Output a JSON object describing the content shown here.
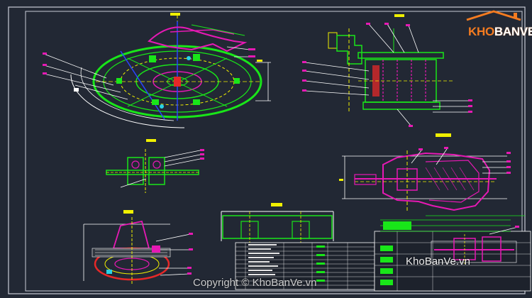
{
  "brand": {
    "logo_kho": "KHO",
    "logo_banve": "BANVE",
    "watermark": "KhoBanVe.vn",
    "copyright": "Copyright © KhoBanVe.vn"
  },
  "colors": {
    "background": "#222834",
    "frame": "#c8ccd6",
    "green": "#19e619",
    "magenta": "#e619b4",
    "yellow": "#f0f000",
    "red": "#e62828",
    "cyan": "#28d2e6",
    "blue": "#2846ff",
    "white": "#ffffff",
    "orange": "#f47b20"
  }
}
